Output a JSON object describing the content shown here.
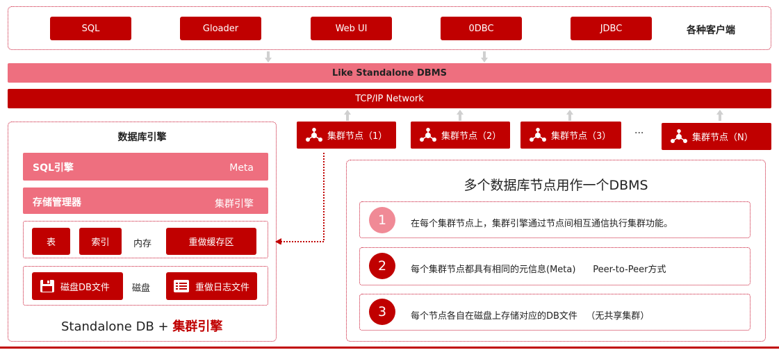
{
  "clients": {
    "buttons": [
      "SQL",
      "Gloader",
      "Web UI",
      "0DBC",
      "JDBC"
    ],
    "label": "各种客户端"
  },
  "layers": {
    "like_standalone": "Like Standalone DBMS",
    "network": "TCP/IP Network"
  },
  "engine": {
    "title": "数据库引擎",
    "sql_engine": "SQL引擎",
    "meta": "Meta",
    "storage_manager": "存储管理器",
    "cluster_engine": "集群引擎",
    "memory_items": [
      "表",
      "索引"
    ],
    "memory_label": "内存",
    "redo_buffer": "重做缓存区",
    "disk_file": "磁盘DB文件",
    "disk_label": "磁盘",
    "redo_log": "重做日志文件",
    "footer_prefix": "Standalone DB +",
    "footer_highlight": "集群引擎"
  },
  "nodes": {
    "items": [
      "集群节点（1）",
      "集群节点（2）",
      "集群节点（3）",
      "集群节点（N）"
    ],
    "ellipsis": "···"
  },
  "summary": {
    "title": "多个数据库节点用作一个DBMS",
    "points": [
      {
        "num": "1",
        "text": "在每个集群节点上，集群引擎通过节点间相互通信执行集群功能。"
      },
      {
        "num": "2",
        "text": "每个集群节点都具有相同的元信息(Meta)      Peer-to-Peer方式"
      },
      {
        "num": "3",
        "text": "每个节点各自在磁盘上存储对应的DB文件   （无共享集群）"
      }
    ]
  },
  "colors": {
    "dark_red": "#c00000",
    "pink": "#ee6f7f",
    "light_pink": "#f08a96"
  }
}
